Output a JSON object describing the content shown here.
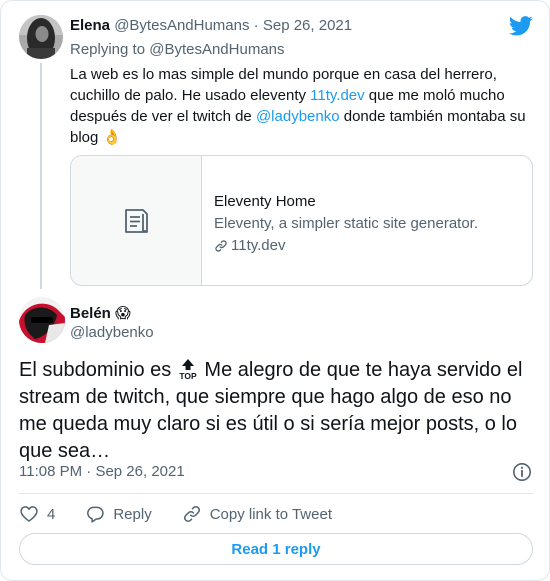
{
  "colors": {
    "accent": "#1d9bf0",
    "muted": "#536471",
    "text": "#0f1419",
    "border": "#cfd9de"
  },
  "parent_tweet": {
    "name": "Elena",
    "handle": "@BytesAndHumans",
    "dot": " · ",
    "date": "Sep 26, 2021",
    "replying_prefix": "Replying to ",
    "replying_handle": "@BytesAndHumans",
    "text_1": "La web es lo mas simple del mundo porque en casa del herrero, cuchillo de palo. He usado eleventy ",
    "link_1": "11ty.dev",
    "text_2": " que me moló mucho después de ver el twitch de ",
    "mention": "@ladybenko",
    "text_3": " donde también montaba su blog ",
    "emoji": "👌"
  },
  "link_card": {
    "title": "Eleventy Home",
    "description": "Eleventy, a simpler static site generator.",
    "domain": "11ty.dev",
    "icons": {
      "thumb": "document-icon",
      "domain": "link-icon"
    }
  },
  "main_tweet": {
    "name": "Belén",
    "name_emoji": "😱",
    "handle": "@ladybenko",
    "text_before": "El subdominio es ",
    "emoji": "top-arrow-emoji",
    "text_after": " Me alegro de que te haya servido el stream de twitch, que siempre que hago algo de eso no me queda muy claro si es útil o si sería mejor posts, o lo que sea…",
    "time": "11:08 PM",
    "dot": " · ",
    "date": "Sep 26, 2021"
  },
  "actions": {
    "like_count": "4",
    "reply_label": "Reply",
    "copy_label": "Copy link to Tweet"
  },
  "read_replies_label": "Read 1 reply",
  "icons": {
    "brand": "twitter-bird-icon",
    "info": "info-icon",
    "like": "heart-icon",
    "reply": "reply-bubble-icon",
    "copy": "link-icon"
  }
}
